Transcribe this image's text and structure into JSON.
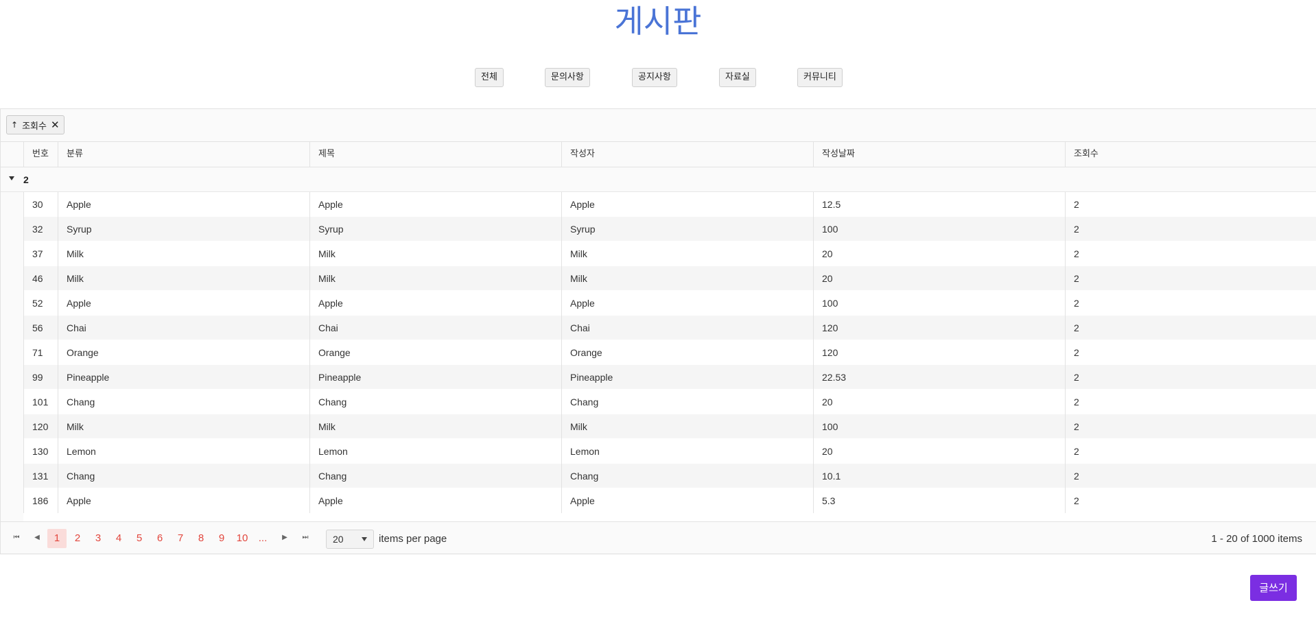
{
  "page": {
    "title": "게시판"
  },
  "categories": [
    "전체",
    "문의사항",
    "공지사항",
    "자료실",
    "커뮤니티"
  ],
  "grid": {
    "sort_chip": {
      "arrow": "↑",
      "label": "조회수",
      "remove_icon": "✕"
    },
    "columns": [
      "번호",
      "분류",
      "제목",
      "작성자",
      "작성날짜",
      "조회수"
    ],
    "group": {
      "label": "2",
      "expanded": true
    },
    "rows": [
      [
        "30",
        "Apple",
        "Apple",
        "Apple",
        "12.5",
        "2"
      ],
      [
        "32",
        "Syrup",
        "Syrup",
        "Syrup",
        "100",
        "2"
      ],
      [
        "37",
        "Milk",
        "Milk",
        "Milk",
        "20",
        "2"
      ],
      [
        "46",
        "Milk",
        "Milk",
        "Milk",
        "20",
        "2"
      ],
      [
        "52",
        "Apple",
        "Apple",
        "Apple",
        "100",
        "2"
      ],
      [
        "56",
        "Chai",
        "Chai",
        "Chai",
        "120",
        "2"
      ],
      [
        "71",
        "Orange",
        "Orange",
        "Orange",
        "120",
        "2"
      ],
      [
        "99",
        "Pineapple",
        "Pineapple",
        "Pineapple",
        "22.53",
        "2"
      ],
      [
        "101",
        "Chang",
        "Chang",
        "Chang",
        "20",
        "2"
      ],
      [
        "120",
        "Milk",
        "Milk",
        "Milk",
        "100",
        "2"
      ],
      [
        "130",
        "Lemon",
        "Lemon",
        "Lemon",
        "20",
        "2"
      ],
      [
        "131",
        "Chang",
        "Chang",
        "Chang",
        "10.1",
        "2"
      ],
      [
        "186",
        "Apple",
        "Apple",
        "Apple",
        "5.3",
        "2"
      ]
    ]
  },
  "pager": {
    "first_icon": "⏮",
    "prev_icon": "◀",
    "next_icon": "▶",
    "last_icon": "⏭",
    "pages": [
      "1",
      "2",
      "3",
      "4",
      "5",
      "6",
      "7",
      "8",
      "9",
      "10",
      "..."
    ],
    "active_page": "1",
    "page_size": "20",
    "items_per_page_label": "items per page",
    "info": "1 - 20 of 1000 items"
  },
  "write_button": "글쓰기",
  "colors": {
    "title": "#4a74d6",
    "accent": "#e2473e",
    "write_button": "#7b2ee2"
  }
}
